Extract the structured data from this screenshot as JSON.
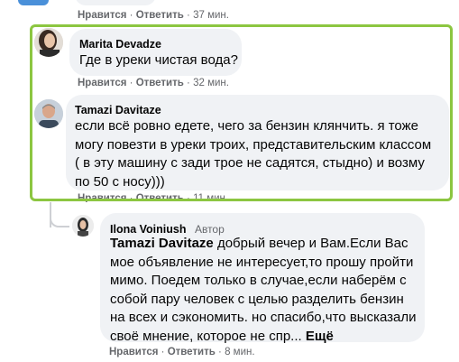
{
  "top_partial": {
    "like": "Нравится",
    "reply": "Ответить",
    "time": "37 мин."
  },
  "comments": [
    {
      "author": "Marita Devadze",
      "text": "Где в уреки чистая вода?",
      "like": "Нравится",
      "reply": "Ответить",
      "time": "32 мин."
    },
    {
      "author": "Tamazi Davitaze",
      "text": "если всё ровно едете, чего за бензин клянчить. я тоже могу повезти в уреки троих, представительским классом ( в эту машину с зади трое не садятся, стыдно) и возму по 50 с носу)))",
      "like": "Нравится",
      "reply": "Ответить",
      "time": "11 мин."
    },
    {
      "author": "Ilona Voiniush",
      "badge": "Автор",
      "mention": "Tamazi Davitaze",
      "text": " добрый вечер и Вам.Если Вас мое объявление не интересует,то прошу пройти мимо. Поедем только в случае,если наберём с собой пару человек с целью разделить бензин на всех и сэкономить. но спасибо,что высказали своё мнение, которое не спр...",
      "more": "Ещё",
      "like": "Нравится",
      "reply": "Ответить",
      "time": "8 мин."
    }
  ],
  "colors": {
    "highlight": "#8cc641",
    "bubble": "#f0f2f5",
    "meta": "#65676b"
  }
}
